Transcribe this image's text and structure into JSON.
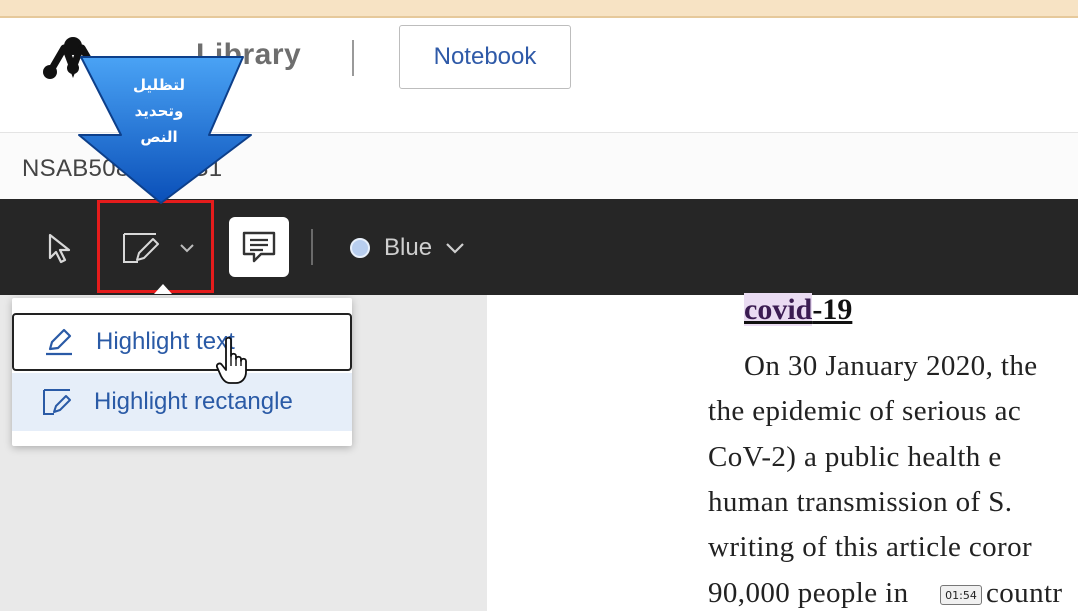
{
  "header": {
    "title": "Library",
    "notebook_button": "Notebook"
  },
  "document": {
    "id": "NSAB5080724-S1",
    "title_prefix": "covid",
    "title_suffix": "-19",
    "lines": [
      "On 30 January 2020, the",
      "the epidemic of serious ac",
      "CoV-2) a public health e",
      "human transmission of S.",
      "writing of this article coror",
      "90,000 people in",
      "countr"
    ]
  },
  "toolbar": {
    "color_label": "Blue",
    "color_hex": "#b8ceef"
  },
  "dropdown": {
    "items": [
      {
        "label": "Highlight text",
        "icon": "pen-icon"
      },
      {
        "label": "Highlight rectangle",
        "icon": "rectangle-pen-icon"
      }
    ]
  },
  "callout": {
    "lines": [
      "لتظليل",
      "وتحديد",
      "النص"
    ],
    "color": "#1e6fd9"
  },
  "video": {
    "timestamp": "01:54"
  },
  "colors": {
    "toolbar_bg": "#262626",
    "accent_blue": "#2a5aa6",
    "highlight_box": "#e51c1c"
  }
}
